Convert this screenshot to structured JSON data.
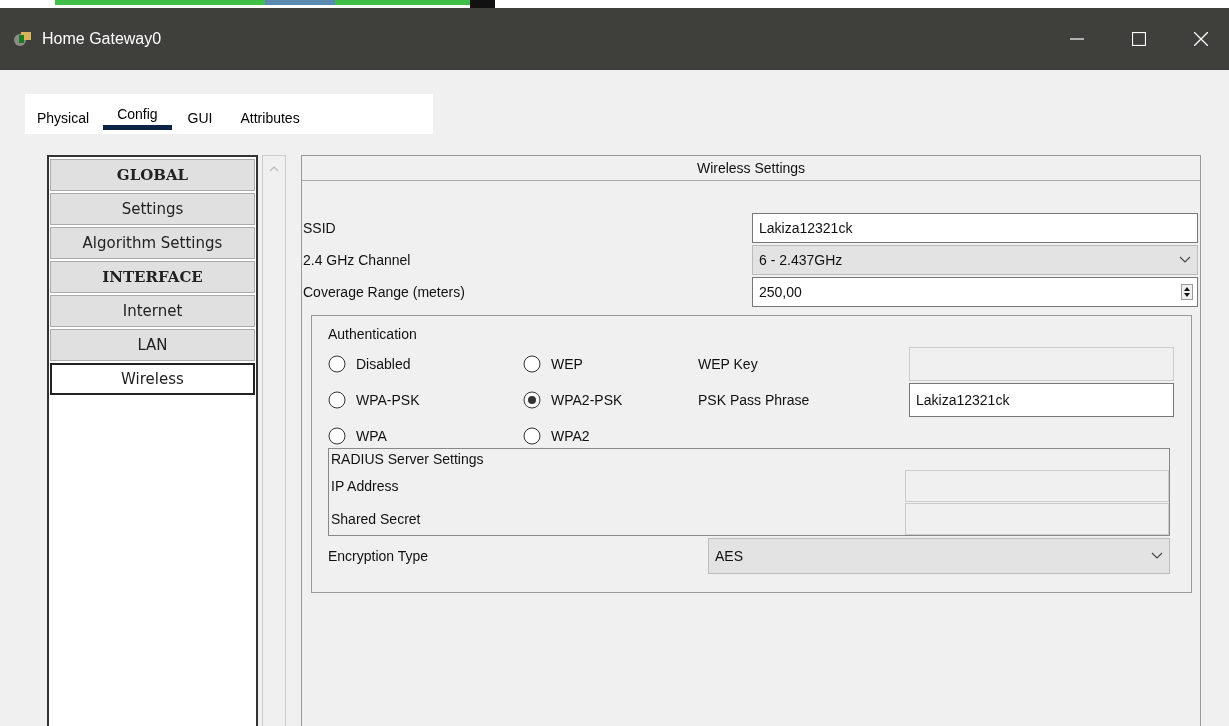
{
  "window": {
    "title": "Home Gateway0"
  },
  "tabs": [
    {
      "label": "Physical",
      "selected": false
    },
    {
      "label": "Config",
      "selected": true
    },
    {
      "label": "GUI",
      "selected": false
    },
    {
      "label": "Attributes",
      "selected": false
    }
  ],
  "sidebar": {
    "items": [
      {
        "label": "GLOBAL",
        "kind": "header",
        "selected": false
      },
      {
        "label": "Settings",
        "kind": "item",
        "selected": false
      },
      {
        "label": "Algorithm Settings",
        "kind": "item",
        "selected": false
      },
      {
        "label": "INTERFACE",
        "kind": "header",
        "selected": false
      },
      {
        "label": "Internet",
        "kind": "item",
        "selected": false
      },
      {
        "label": "LAN",
        "kind": "item",
        "selected": false
      },
      {
        "label": "Wireless",
        "kind": "item",
        "selected": true
      }
    ]
  },
  "panel": {
    "title": "Wireless Settings",
    "ssid": {
      "label": "SSID",
      "value": "Lakiza12321ck"
    },
    "channel": {
      "label": "2.4 GHz Channel",
      "value": "6 - 2.437GHz"
    },
    "coverage": {
      "label": "Coverage Range (meters)",
      "value": "250,00"
    },
    "authentication": {
      "title": "Authentication",
      "options": [
        {
          "label": "Disabled",
          "selected": false
        },
        {
          "label": "WEP",
          "selected": false
        },
        {
          "label": "WPA-PSK",
          "selected": false
        },
        {
          "label": "WPA2-PSK",
          "selected": true
        },
        {
          "label": "WPA",
          "selected": false
        },
        {
          "label": "WPA2",
          "selected": false
        }
      ],
      "wep_key": {
        "label": "WEP Key",
        "disabled": true
      },
      "psk_pass_phrase": {
        "label": "PSK Pass Phrase",
        "value": "Lakiza12321ck",
        "disabled": false
      }
    },
    "radius": {
      "title": "RADIUS Server Settings",
      "fields": [
        {
          "label": "IP Address",
          "disabled": true
        },
        {
          "label": "Shared Secret",
          "disabled": true
        }
      ]
    },
    "encryption": {
      "label": "Encryption Type",
      "value": "AES"
    }
  }
}
